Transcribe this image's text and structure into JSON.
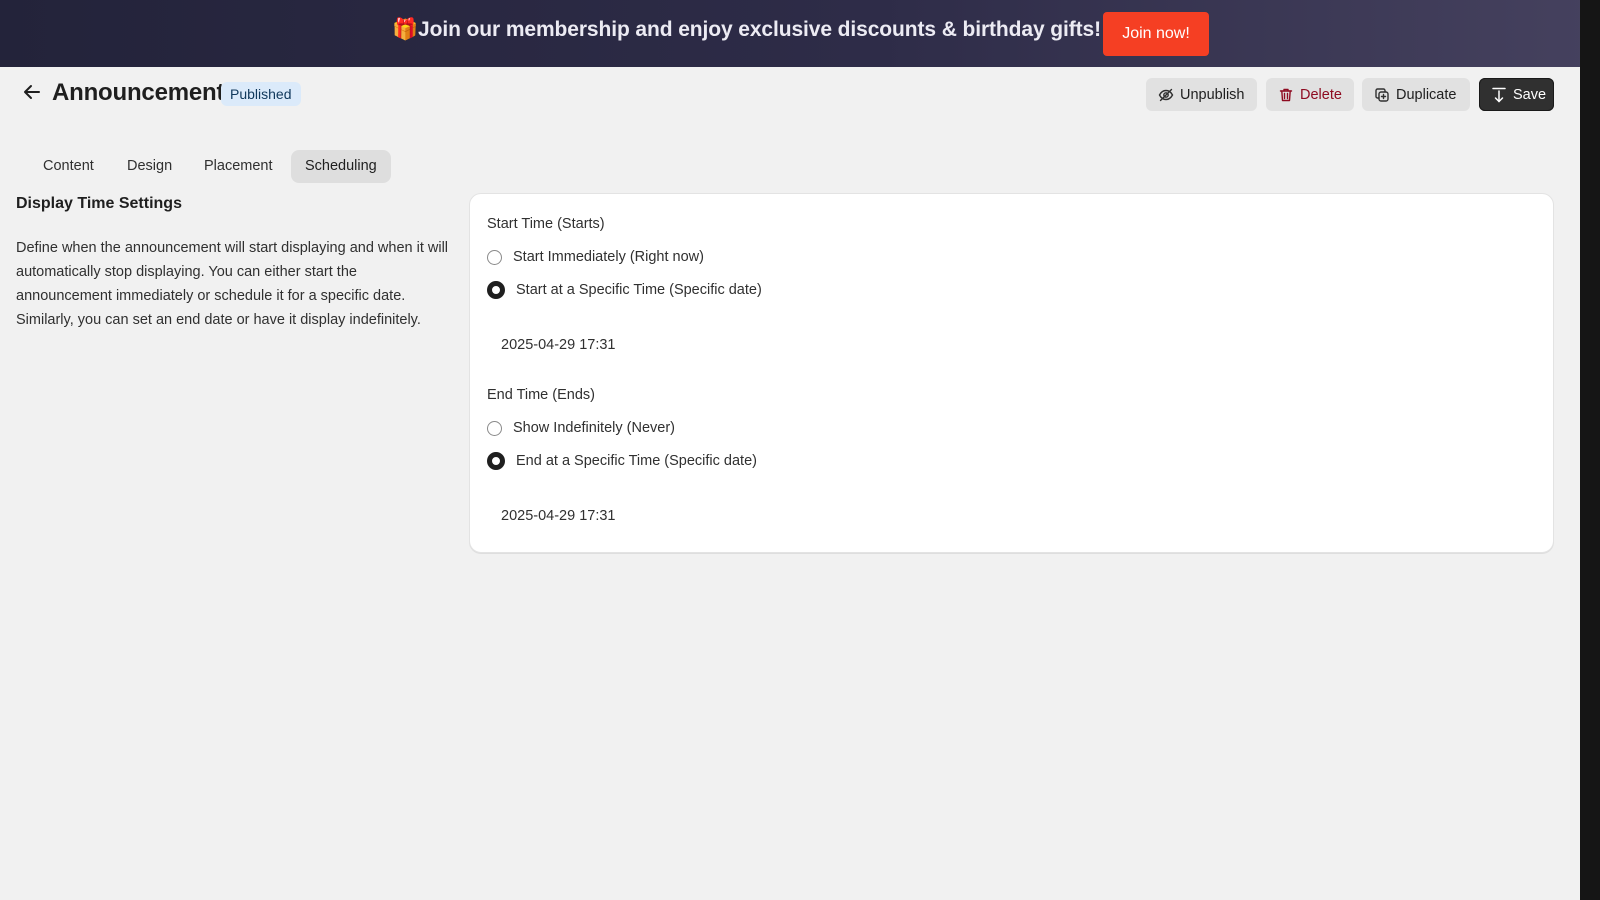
{
  "banner": {
    "text": "🎁Join our membership and enjoy exclusive discounts & birthday gifts!",
    "cta_label": "Join now!"
  },
  "header": {
    "title": "Announcement",
    "status": "Published",
    "actions": {
      "unpublish": "Unpublish",
      "delete": "Delete",
      "duplicate": "Duplicate",
      "save": "Save"
    }
  },
  "tabs": [
    {
      "label": "Content"
    },
    {
      "label": "Design"
    },
    {
      "label": "Placement"
    },
    {
      "label": "Scheduling",
      "active": true
    }
  ],
  "section": {
    "title": "Display Time Settings",
    "description": "Define when the announcement will start displaying and when it will automatically stop displaying. You can either start the announcement immediately or schedule it for a specific date. Similarly, you can set an end date or have it display indefinitely."
  },
  "start": {
    "label": "Start Time (Starts)",
    "options": [
      {
        "label": "Start Immediately (Right now)",
        "selected": false
      },
      {
        "label": "Start at a Specific Time (Specific date)",
        "selected": true
      }
    ],
    "value": "2025-04-29 17:31"
  },
  "end": {
    "label": "End Time (Ends)",
    "options": [
      {
        "label": "Show Indefinitely (Never)",
        "selected": false
      },
      {
        "label": "End at a Specific Time (Specific date)",
        "selected": true
      }
    ],
    "value": "2025-04-29 17:31"
  },
  "colors": {
    "banner_bg": "#2e2c48",
    "cta_bg": "#f53f23",
    "badge_bg": "#dbeafa",
    "delete_text": "#8e0b21",
    "save_bg": "#303030"
  }
}
